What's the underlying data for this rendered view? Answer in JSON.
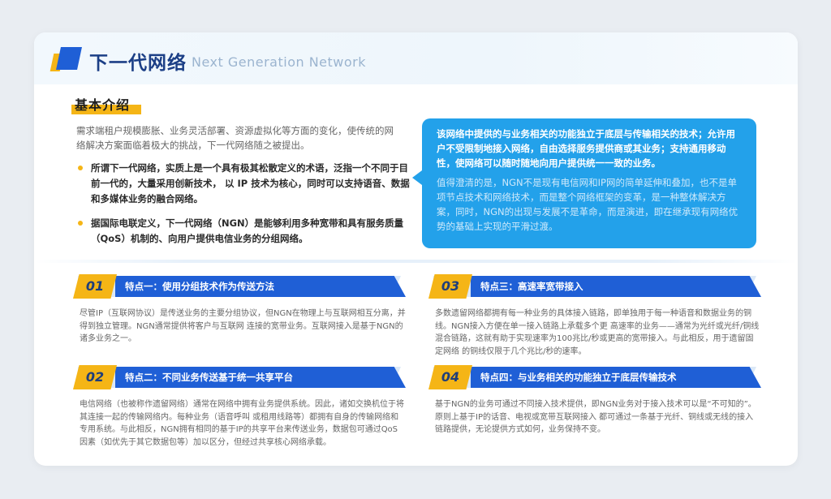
{
  "header": {
    "title_cn": "下一代网络",
    "title_en": "Next Generation Network"
  },
  "intro": {
    "heading": "基本介绍",
    "paragraph": "需求端租户规模膨胀、业务灵活部署、资源虚拟化等方面的变化，使传统的网络解决方案面临着极大的挑战，下一代网络随之被提出。",
    "bullets": [
      "所谓下一代网络，实质上是一个具有极其松散定义的术语，泛指一个不同于目前一代的，大量采用创新技术， 以 IP 技术为核心，同时可以支持语音、数据和多媒体业务的融合网络。",
      "据国际电联定义，下一代网络（NGN）是能够利用多种宽带和具有服务质量（QoS）机制的、向用户提供电信业务的分组网络。"
    ]
  },
  "callout": {
    "bold": "该网络中提供的与业务相关的功能独立于底层与传输相关的技术；允许用户不受限制地接入网络，自由选择服务提供商或其业务；支持通用移动性，使网络可以随时随地向用户提供统一一致的业务。",
    "light": "值得澄清的是，NGN不是现有电信网和IP网的简单延伸和叠加，也不是单项节点技术和网络技术，而是整个网络框架的变革，是一种整体解决方案，同时，NGN的出现与发展不是革命，而是演进，即在继承现有网络优势的基础上实现的平滑过渡。"
  },
  "features": [
    {
      "num": "01",
      "label": "特点一：使用分组技术作为传送方法",
      "desc": "尽管IP（互联网协议）是传送业务的主要分组协议，但NGN在物理上与互联网相互分离，并得到独立管理。NGN通常提供将客户与互联网 连接的宽带业务。互联网接入是基于NGN的诸多业务之一。"
    },
    {
      "num": "02",
      "label": "特点二：不同业务传送基于统一共享平台",
      "desc": "电信网络（也被称作遗留网络）通常在网络中拥有业务提供系统。因此，诸如交换机位于将其连接一起的传输网络内。每种业务（语音呼叫 或租用线路等）都拥有自身的传输网络和专用系统。与此相反，NGN拥有相同的基于IP的共享平台来传送业务，数据包可通过QoS因素（如优先于其它数据包等）加以区分，但经过共享核心网络承载。"
    },
    {
      "num": "03",
      "label": "特点三：高速率宽带接入",
      "desc": "多数遗留网络都拥有每一种业务的具体接入链路，即单独用于每一种语音和数据业务的铜线。NGN接入方便在单一接入链路上承载多个更 高速率的业务——通常为光纤或光纤/铜线混合链路，这就有助于实现速率为100兆比/秒或更高的宽带接入。与此相反，用于遗留固定网络 的铜线仅限于几个兆比/秒的速率。"
    },
    {
      "num": "04",
      "label": "特点四：与业务相关的功能独立于底层传输技术",
      "desc": "基于NGN的业务可通过不同接入技术提供，即NGN业务对于接入技术可以是“不可知的”。原则上基于IP的话音、电视或宽带互联网接入 都可通过一条基于光纤、铜线或无线的接入链路提供，无论提供方式如何，业务保持不变。"
    }
  ]
}
